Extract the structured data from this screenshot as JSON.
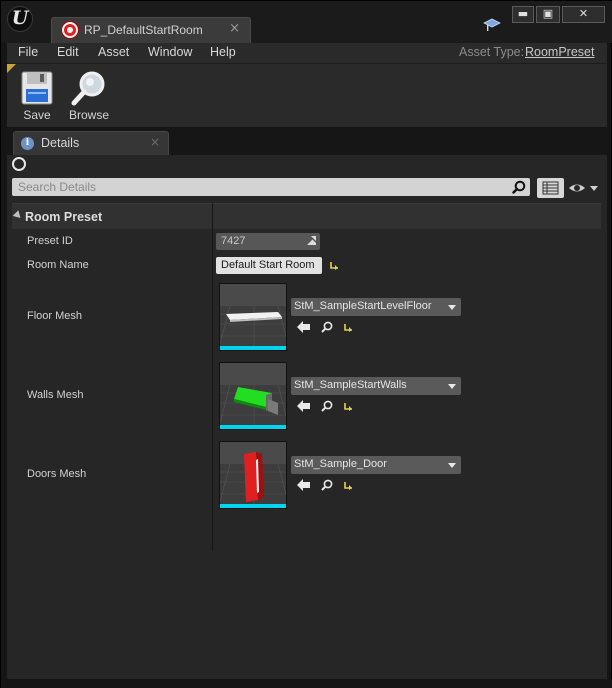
{
  "window": {
    "tab_title": "RP_DefaultStartRoom",
    "tab_close": "×",
    "controls": {
      "minimize": "▬",
      "maximize": "▣",
      "close": "✕"
    }
  },
  "menu": {
    "items": [
      "File",
      "Edit",
      "Asset",
      "Window",
      "Help"
    ],
    "asset_type_label": "Asset Type:",
    "asset_type_value": "RoomPreset"
  },
  "toolbar": {
    "save_label": "Save",
    "browse_label": "Browse"
  },
  "details": {
    "tab_label": "Details",
    "tab_close": "×",
    "search_placeholder": "Search Details",
    "category": "Room Preset",
    "properties": {
      "preset_id": {
        "label": "Preset ID",
        "value": "7427"
      },
      "room_name": {
        "label": "Room Name",
        "value": "Default Start Room"
      },
      "floor_mesh": {
        "label": "Floor Mesh",
        "asset": "StM_SampleStartLevelFloor"
      },
      "walls_mesh": {
        "label": "Walls Mesh",
        "asset": "StM_SampleStartWalls"
      },
      "doors_mesh": {
        "label": "Doors Mesh",
        "asset": "StM_Sample_Door"
      }
    }
  },
  "colors": {
    "accent_cyan": "#00d4ee",
    "reset_yellow": "#e6d44a",
    "asset_red": "#e02020",
    "asset_green": "#22dd22"
  }
}
